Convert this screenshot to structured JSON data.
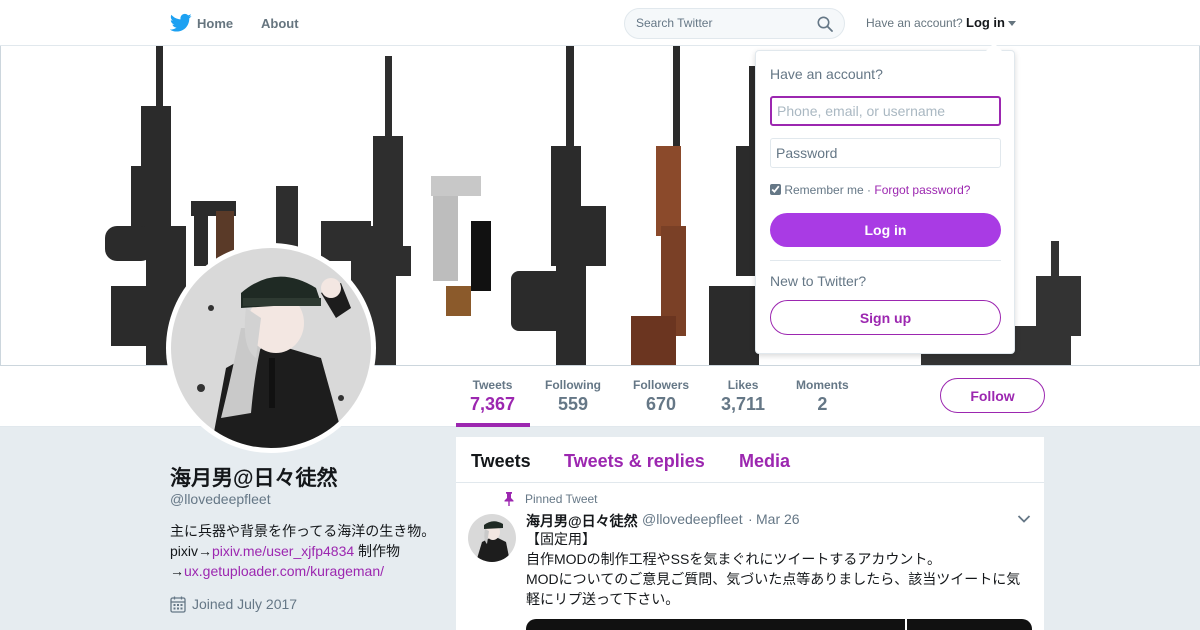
{
  "nav": {
    "home": "Home",
    "about": "About",
    "search_placeholder": "Search Twitter",
    "have_account": "Have an account?",
    "login": "Log in"
  },
  "profile": {
    "name": "海月男@日々徒然",
    "handle": "@llovedeepfleet",
    "bio_text_1": "主に兵器や背景を作ってる海洋の生き物。pixiv→",
    "bio_link_1": "pixiv.me/user_xjfp4834",
    "bio_text_2": " 制作物→",
    "bio_link_2": "ux.getuploader.com/kurageman/",
    "joined": "Joined July 2017"
  },
  "stats": [
    {
      "label": "Tweets",
      "value": "7,367"
    },
    {
      "label": "Following",
      "value": "559"
    },
    {
      "label": "Followers",
      "value": "670"
    },
    {
      "label": "Likes",
      "value": "3,711"
    },
    {
      "label": "Moments",
      "value": "2"
    }
  ],
  "follow_button": "Follow",
  "tabs": [
    "Tweets",
    "Tweets & replies",
    "Media"
  ],
  "tweet": {
    "pinned_label": "Pinned Tweet",
    "author": "海月男@日々徒然",
    "handle": "@llovedeepfleet",
    "dot": "·",
    "date": "Mar 26",
    "line1": "【固定用】",
    "line2": "自作MODの制作工程やSSを気まぐれにツイートするアカウント。",
    "line3": "MODについてのご意見ご質問、気づいた点等ありましたら、該当ツイートに気軽にリプ送って下さい。"
  },
  "login_dropdown": {
    "title": "Have an account?",
    "username_placeholder": "Phone, email, or username",
    "password_placeholder": "Password",
    "remember_me": "Remember me",
    "separator": " · ",
    "forgot": "Forgot password?",
    "login_button": "Log in",
    "new_to": "New to Twitter?",
    "signup_button": "Sign up"
  },
  "colors": {
    "accent": "#9c27b0",
    "login_button_bg": "#a93be4",
    "background": "#e6ecf0"
  },
  "icons": {
    "logo": "twitter-bird-icon",
    "search": "search-icon",
    "dropdown": "caret-down-icon",
    "calendar": "calendar-icon",
    "pin": "pin-icon",
    "tweet_menu": "chevron-down-icon"
  }
}
